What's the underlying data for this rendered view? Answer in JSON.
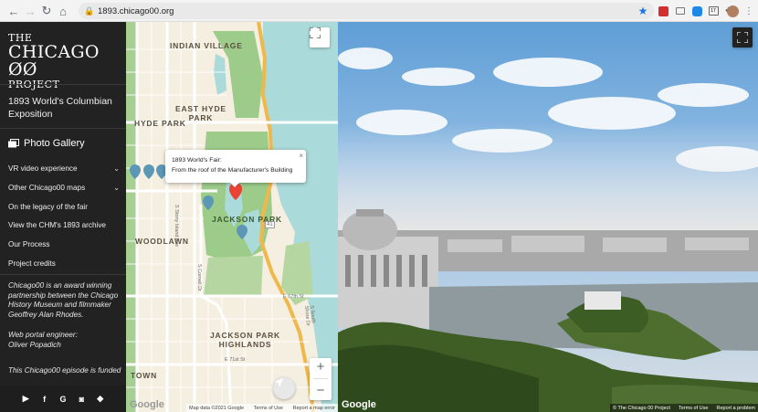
{
  "browser": {
    "url": "1893.chicago00.org",
    "ext_badge": "17"
  },
  "sidebar": {
    "logo": {
      "line1": "THE",
      "line2": "CHICAGO ØØ",
      "line3": "PROJECT"
    },
    "episode_title": "1893 World's Columbian Exposition",
    "gallery_label": "Photo Gallery",
    "menu": [
      {
        "label": "VR video experience",
        "has_chevron": true
      },
      {
        "label": "Other Chicago00 maps",
        "has_chevron": true
      },
      {
        "label": "On the legacy of the fair",
        "has_chevron": false
      },
      {
        "label": "View the CHM's 1893 archive",
        "has_chevron": false
      },
      {
        "label": "Our Process",
        "has_chevron": false
      },
      {
        "label": "Project credits",
        "has_chevron": false
      }
    ],
    "about": "Chicago00 is an award winning partnership between the Chicago History Museum and filmmaker Geoffrey Alan Rhodes.",
    "engineer_label": "Web portal engineer:",
    "engineer_name": "Oliver Popadich",
    "funding": "This Chicago00 episode is funded",
    "social_icons": [
      "youtube-icon",
      "facebook-icon",
      "google-icon",
      "instagram-icon",
      "diamond-icon"
    ],
    "social_glyphs": [
      "▶",
      "f",
      "G",
      "◙",
      "◆"
    ]
  },
  "map": {
    "labels": {
      "indian_village": "INDIAN VILLAGE",
      "east_hyde_park": "EAST HYDE\nPARK",
      "hyde_park": "HYDE PARK",
      "jackson_park": "JACKSON PARK",
      "woodlawn": "WOODLAWN",
      "jackson_park_highlands": "JACKSON PARK\nHIGHLANDS",
      "town": "TOWN"
    },
    "streets": {
      "stony_island": "S Stony Island Ave",
      "cornell": "S Cornell Dr",
      "e67": "E 67th St",
      "e71": "E 71st St",
      "south_shore": "S South Shore Dr",
      "route_41": "41"
    },
    "popup": {
      "line1": "1893 World's Fair:",
      "line2": "From the roof of the Manufacturer's Building",
      "close": "×"
    },
    "zoom_in": "+",
    "zoom_out": "−",
    "attribution": {
      "data": "Map data ©2021 Google",
      "terms": "Terms of Use",
      "report": "Report a map error"
    },
    "google_logo": "Google"
  },
  "pano": {
    "google_logo": "Google",
    "attribution": {
      "copyright": "© The Chicago 00 Project",
      "terms": "Terms of Use",
      "report": "Report a problem"
    }
  },
  "colors": {
    "sidebar_bg": "#222222",
    "water": "#aadad9",
    "park": "#9ccb8a",
    "highway": "#f0b84a",
    "marker_red": "#ea4335",
    "marker_blue": "#5d97b6"
  }
}
